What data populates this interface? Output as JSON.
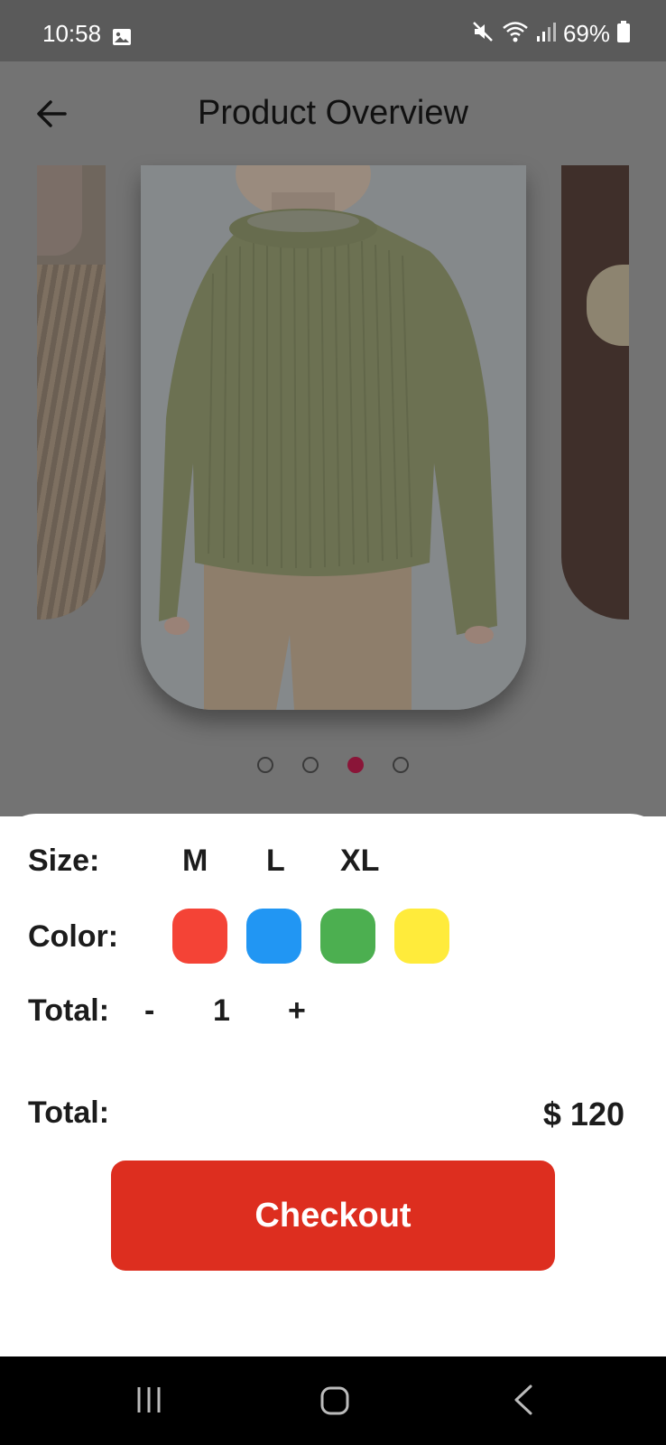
{
  "status_bar": {
    "time": "10:58",
    "battery": "69%",
    "icons": [
      "gallery-icon",
      "mute-icon",
      "wifi-icon",
      "signal-icon",
      "battery-icon"
    ]
  },
  "header": {
    "title": "Product Overview",
    "back_icon": "arrow-left-icon"
  },
  "carousel": {
    "dots": 4,
    "active_index": 2,
    "active_color": "#8a1538"
  },
  "options": {
    "size_label": "Size:",
    "sizes": [
      "M",
      "L",
      "XL"
    ],
    "color_label": "Color:",
    "colors": [
      "#f44336",
      "#2196f3",
      "#4caf50",
      "#ffeb3b"
    ],
    "quantity_label": "Total:",
    "decrement": "-",
    "quantity": "1",
    "increment": "+"
  },
  "summary": {
    "total_label": "Total:",
    "total_value": "$ 120"
  },
  "checkout": {
    "label": "Checkout",
    "color": "#dd2e1f"
  },
  "nav_bar": {
    "icons": [
      "recent-apps-icon",
      "home-icon",
      "back-icon"
    ]
  }
}
